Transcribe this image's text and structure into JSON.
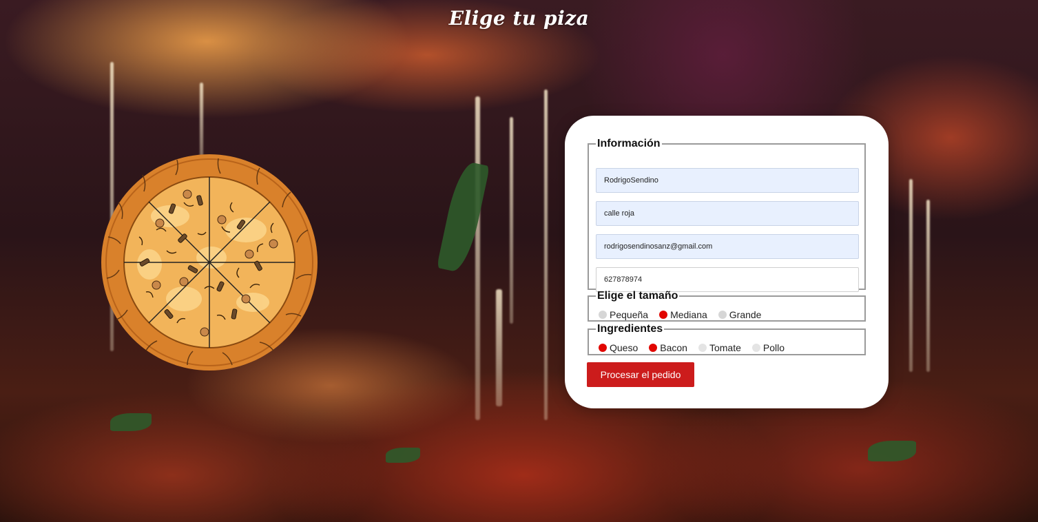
{
  "header": {
    "title": "Elige tu piza"
  },
  "form": {
    "info": {
      "legend": "Información",
      "name_value": "RodrigoSendino",
      "address_value": "calle roja",
      "email_value": "rodrigosendinosanz@gmail.com",
      "phone_value": "627878974"
    },
    "size": {
      "legend": "Elige el tamaño",
      "options": [
        {
          "label": "Pequeña",
          "selected": false
        },
        {
          "label": "Mediana",
          "selected": true
        },
        {
          "label": "Grande",
          "selected": false
        }
      ]
    },
    "ingredients": {
      "legend": "Ingredientes",
      "options": [
        {
          "label": "Queso",
          "checked": true
        },
        {
          "label": "Bacon",
          "checked": true
        },
        {
          "label": "Tomate",
          "checked": false
        },
        {
          "label": "Pollo",
          "checked": false
        }
      ]
    },
    "submit_label": "Procesar el pedido"
  },
  "colors": {
    "accent": "#cc1c1c",
    "selected_dot": "#e10600",
    "autofill_bg": "#e8f0fe"
  },
  "icons": {
    "pizza": "pizza-illustration"
  }
}
